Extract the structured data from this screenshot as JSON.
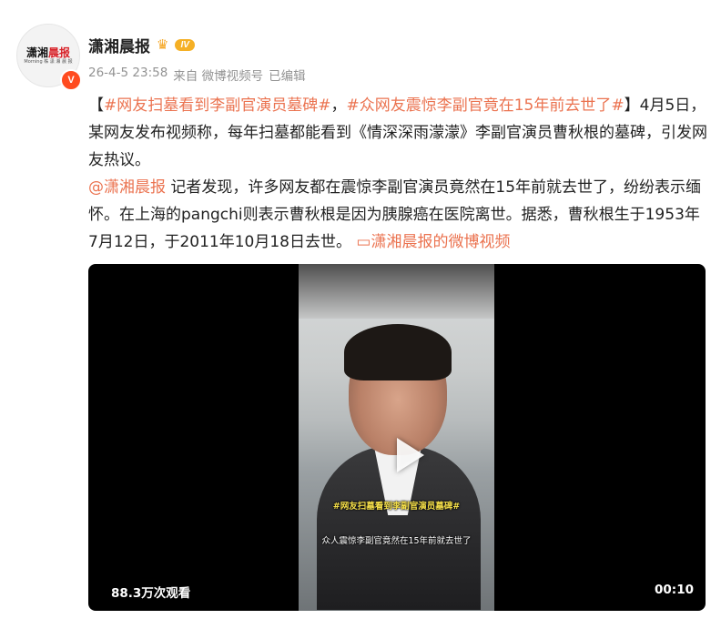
{
  "post": {
    "author": {
      "name": "潇湘晨报",
      "avatar_logo_black": "潇湘",
      "avatar_logo_red": "晨报",
      "avatar_logo_sub": "Morning 株 潇 湘 晨 报",
      "verified_badge": "V",
      "member_icon": "crown-icon",
      "level_badge": "IV"
    },
    "meta": {
      "timestamp": "26-4-5 23:58",
      "source": "来自 微博视频号",
      "edited": "已编辑"
    },
    "content": {
      "bracket_open": "【",
      "hashtag1": "#网友扫墓看到李副官演员墓碑#",
      "separator": "，",
      "hashtag2": "#众网友震惊李副官竟在15年前去世了#",
      "paragraph1_rest": "】4月5日，某网友发布视频称，每年扫墓都能看到《情深深雨濛濛》李副官演员曹秋根的墓碑，引发网友热议。",
      "mention": "@潇湘晨报",
      "paragraph2_rest": " 记者发现，许多网友都在震惊李副官演员竟然在15年前就去世了，纷纷表示缅怀。在上海的pangchi则表示曹秋根是因为胰腺癌在医院离世。据悉，曹秋根生于1953年7月12日，于2011年10月18日去世。",
      "video_link_icon": "video-link-icon",
      "video_link_label": "潇湘晨报的微博视频"
    },
    "video": {
      "overlay_hashtag": "#网友扫墓看到李副官演员墓碑#",
      "overlay_subtitle": "众人震惊李副官竟然在15年前就去世了",
      "views": "88.3万次观看",
      "duration": "00:10",
      "play_icon": "play-icon"
    }
  }
}
